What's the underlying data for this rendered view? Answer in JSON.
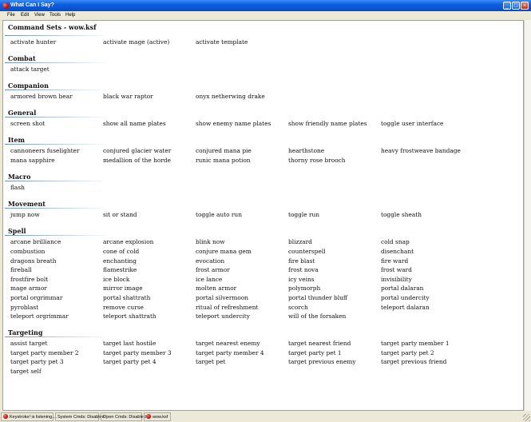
{
  "window": {
    "title": "What Can I Say?"
  },
  "menu": [
    "File",
    "Edit",
    "View",
    "Tools",
    "Help"
  ],
  "page_title": "Command Sets - wow.ksf",
  "sections": [
    {
      "title": "",
      "rows": [
        [
          "activate hunter",
          "activate mage (active)",
          "activate template"
        ]
      ]
    },
    {
      "title": "Combat",
      "rows": [
        [
          "attack target"
        ]
      ]
    },
    {
      "title": "Companion",
      "rows": [
        [
          "armored brown bear",
          "black war raptor",
          "onyx netherwing drake"
        ]
      ]
    },
    {
      "title": "General",
      "rows": [
        [
          "screen shot",
          "show all name plates",
          "show enemy name plates",
          "show friendly name plates",
          "toggle user interface"
        ]
      ]
    },
    {
      "title": "Item",
      "rows": [
        [
          "cannoneers fuselighter",
          "conjured glacier water",
          "conjured mana pie",
          "hearthstone",
          "heavy frostweave bandage"
        ],
        [
          "mana sapphire",
          "medallion of the horde",
          "runic mana potion",
          "thorny rose brooch"
        ]
      ]
    },
    {
      "title": "Macro",
      "rows": [
        [
          "flash"
        ]
      ]
    },
    {
      "title": "Movement",
      "rows": [
        [
          "jump now",
          "sit or stand",
          "toggle auto run",
          "toggle run",
          "toggle sheath"
        ]
      ]
    },
    {
      "title": "Spell",
      "rows": [
        [
          "arcane brilliance",
          "arcane explosion",
          "blink now",
          "blizzard",
          "cold snap"
        ],
        [
          "combustion",
          "cone of cold",
          "conjure mana gem",
          "counterspell",
          "disenchant"
        ],
        [
          "dragons breath",
          "enchanting",
          "evocation",
          "fire blast",
          "fire ward"
        ],
        [
          "fireball",
          "flamestrike",
          "frost armor",
          "frost nova",
          "frost ward"
        ],
        [
          "frostfire bolt",
          "ice block",
          "ice lance",
          "icy veins",
          "invisibility"
        ],
        [
          "mage armor",
          "mirror image",
          "molten armor",
          "polymorph",
          "portal dalaran"
        ],
        [
          "portal orgrimmar",
          "portal shattrath",
          "portal silvermoon",
          "portal thunder bluff",
          "portal undercity"
        ],
        [
          "pyroblast",
          "remove curse",
          "ritual of refreshment",
          "scorch",
          "teleport dalaran"
        ],
        [
          "teleport orgrimmar",
          "teleport shattrath",
          "teleport undercity",
          "will of the forsaken"
        ]
      ]
    },
    {
      "title": "Targeting",
      "rows": [
        [
          "assist target",
          "target last hostile",
          "target nearest enemy",
          "target nearest friend",
          "target party member 1"
        ],
        [
          "target party member 2",
          "target party member 3",
          "target party member 4",
          "target party pet 1",
          "target party pet 2"
        ],
        [
          "target party pet 3",
          "target party pet 4",
          "target pet",
          "target previous enemy",
          "target previous friend"
        ],
        [
          "target self"
        ]
      ]
    }
  ],
  "status": {
    "listening": "Keystroke! is listening....",
    "system_cmds": "System Cmds: Disabled",
    "open_cmds": "Open Cmds: Disabled",
    "file": "wow.ksf"
  },
  "colors": {
    "titlebar": "#0a50c8",
    "heading_rule": "#6a90c8",
    "background": "#ece9d8"
  }
}
